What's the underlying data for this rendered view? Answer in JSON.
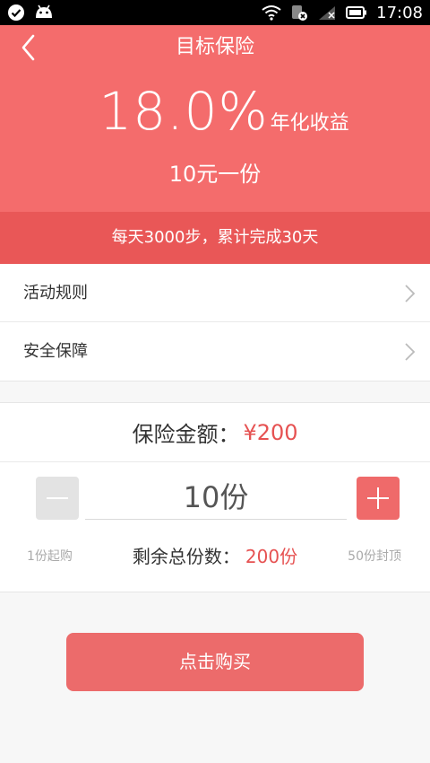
{
  "status_bar": {
    "time": "17:08",
    "icons": [
      "check-circle-icon",
      "android-icon",
      "wifi-icon",
      "sim-no-service-icon",
      "signal-off-icon",
      "battery-icon"
    ]
  },
  "header": {
    "title": "目标保险",
    "rate": "18.0%",
    "rate_label": "年化收益",
    "price": "10元一份"
  },
  "banner": {
    "text": "每天3000步，累计完成30天"
  },
  "list": {
    "items": [
      {
        "label": "活动规则"
      },
      {
        "label": "安全保障"
      }
    ]
  },
  "purchase": {
    "amount_label": "保险金额：",
    "amount_value": "¥200",
    "quantity": "10份",
    "min_note": "1份起购",
    "max_note": "50份封顶",
    "remaining_label": "剩余总份数：",
    "remaining_value": "200份",
    "buy_label": "点击购买"
  },
  "colors": {
    "header_bg": "#f46c6c",
    "banner_bg": "#e95757",
    "accent": "#e65252",
    "button": "#ec6b6b"
  }
}
